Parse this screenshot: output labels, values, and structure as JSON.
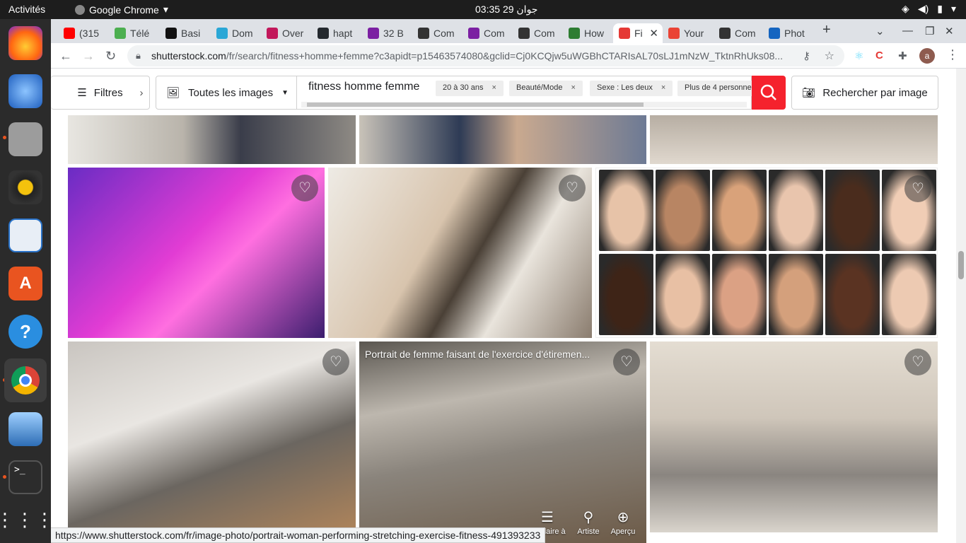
{
  "topbar": {
    "activities": "Activités",
    "app_name": "Google Chrome",
    "clock": "03:35  جوان 29"
  },
  "dock": {
    "items": [
      "firefox-icon",
      "thunderbird-icon",
      "files-icon",
      "rhythmbox-icon",
      "writer-icon",
      "software-icon",
      "help-icon",
      "chrome-icon",
      "photos-icon",
      "terminal-icon",
      "app-grid-icon"
    ]
  },
  "tabs": [
    {
      "label": "(315",
      "color": "#ff0000"
    },
    {
      "label": "Télé",
      "color": "#4caf50"
    },
    {
      "label": "Basi",
      "color": "#111111"
    },
    {
      "label": "Dom",
      "color": "#2aa7d6"
    },
    {
      "label": "Over",
      "color": "#c2185b"
    },
    {
      "label": "hapt",
      "color": "#24292e"
    },
    {
      "label": "32 B",
      "color": "#7b1fa2"
    },
    {
      "label": "Com",
      "color": "#333333"
    },
    {
      "label": "Com",
      "color": "#7b1fa2"
    },
    {
      "label": "Com",
      "color": "#333333"
    },
    {
      "label": "How",
      "color": "#2e7d32"
    },
    {
      "label": "Fi",
      "color": "#e53935",
      "active": true
    },
    {
      "label": "Your",
      "color": "#ea4335"
    },
    {
      "label": "Com",
      "color": "#333333"
    },
    {
      "label": "Phot",
      "color": "#1565c0"
    }
  ],
  "toolbar": {
    "url_host": "shutterstock.com",
    "url_path": "/fr/search/fitness+homme+femme?c3apidt=p15463574080&gclid=Cj0KCQjw5uWGBhCTARIsAL70sLJ1mNzW_TktnRhUks08...",
    "avatar_letter": "a"
  },
  "search": {
    "filters_label": "Filtres",
    "expand_glyph": "›",
    "scope_label": "Toutes les images",
    "query": "fitness homme femme",
    "chips": [
      "20 à 30 ans",
      "Beauté/Mode",
      "Sexe : Les deux",
      "Plus de 4 personne"
    ],
    "chip_close": "×",
    "reverse_search_label": "Rechercher par image"
  },
  "results": {
    "hover_caption": "Portrait de femme faisant de l'exercice d'étiremen...",
    "actions": {
      "similar": "Similaire à",
      "artist": "Artiste",
      "preview": "Aperçu"
    }
  },
  "status_url": "https://www.shutterstock.com/fr/image-photo/portrait-woman-performing-stretching-exercise-fitness-491393233",
  "colors": {
    "accent": "#f5222d",
    "dock_bg": "#2b2b2b",
    "topbar_bg": "#1d1d1d"
  }
}
